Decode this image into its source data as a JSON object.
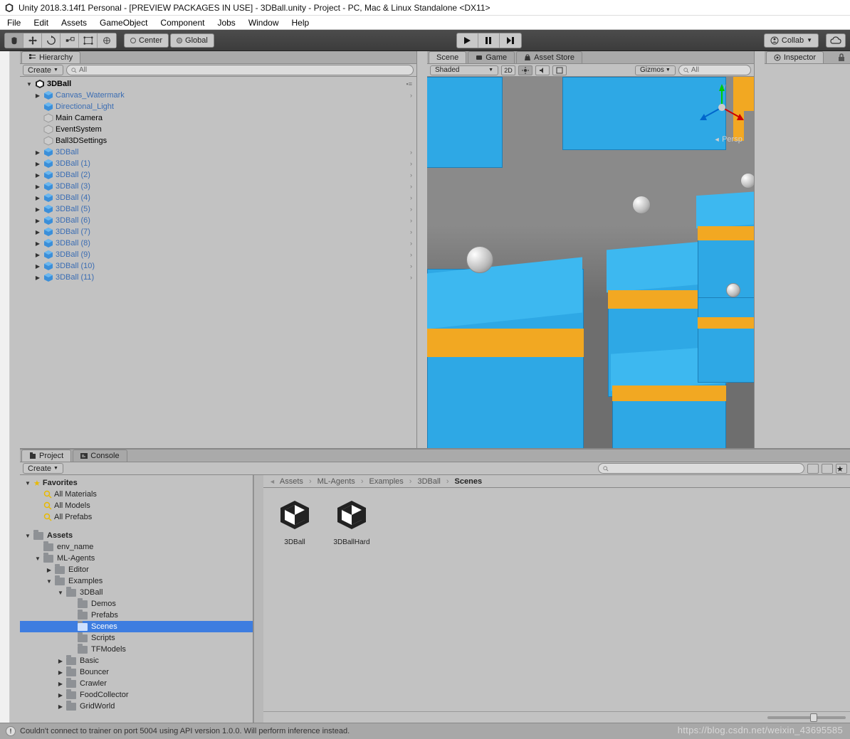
{
  "window_title": "Unity 2018.3.14f1 Personal - [PREVIEW PACKAGES IN USE] - 3DBall.unity - Project - PC, Mac & Linux Standalone <DX11>",
  "menus": [
    "File",
    "Edit",
    "Assets",
    "GameObject",
    "Component",
    "Jobs",
    "Window",
    "Help"
  ],
  "toolbar": {
    "pivot_labels": [
      "Center",
      "Global"
    ],
    "collab": "Collab"
  },
  "hierarchy": {
    "tab": "Hierarchy",
    "create": "Create",
    "search_placeholder": "All",
    "root": "3DBall",
    "items": [
      {
        "label": "Canvas_Watermark",
        "blue": true,
        "arrow": "closed",
        "chev": true
      },
      {
        "label": "Directional_Light",
        "blue": true,
        "arrow": "none",
        "chev": false
      },
      {
        "label": "Main Camera",
        "blue": false,
        "arrow": "none",
        "chev": false,
        "dim": true
      },
      {
        "label": "EventSystem",
        "blue": false,
        "arrow": "none",
        "chev": false,
        "dim": true
      },
      {
        "label": "Ball3DSettings",
        "blue": false,
        "arrow": "none",
        "chev": false,
        "dim": true
      },
      {
        "label": "3DBall",
        "blue": true,
        "arrow": "closed",
        "chev": true
      },
      {
        "label": "3DBall (1)",
        "blue": true,
        "arrow": "closed",
        "chev": true
      },
      {
        "label": "3DBall (2)",
        "blue": true,
        "arrow": "closed",
        "chev": true
      },
      {
        "label": "3DBall (3)",
        "blue": true,
        "arrow": "closed",
        "chev": true
      },
      {
        "label": "3DBall (4)",
        "blue": true,
        "arrow": "closed",
        "chev": true
      },
      {
        "label": "3DBall (5)",
        "blue": true,
        "arrow": "closed",
        "chev": true
      },
      {
        "label": "3DBall (6)",
        "blue": true,
        "arrow": "closed",
        "chev": true
      },
      {
        "label": "3DBall (7)",
        "blue": true,
        "arrow": "closed",
        "chev": true
      },
      {
        "label": "3DBall (8)",
        "blue": true,
        "arrow": "closed",
        "chev": true
      },
      {
        "label": "3DBall (9)",
        "blue": true,
        "arrow": "closed",
        "chev": true
      },
      {
        "label": "3DBall (10)",
        "blue": true,
        "arrow": "closed",
        "chev": true
      },
      {
        "label": "3DBall (11)",
        "blue": true,
        "arrow": "closed",
        "chev": true
      }
    ]
  },
  "scene": {
    "tabs": [
      "Scene",
      "Game",
      "Asset Store"
    ],
    "shading": "Shaded",
    "controls": {
      "2d": "2D",
      "gizmos": "Gizmos",
      "search": "All"
    },
    "persp": "Persp"
  },
  "inspector": {
    "tab": "Inspector"
  },
  "project": {
    "tabs": [
      "Project",
      "Console"
    ],
    "create": "Create",
    "breadcrumb": [
      "Assets",
      "ML-Agents",
      "Examples",
      "3DBall",
      "Scenes"
    ],
    "favorites_label": "Favorites",
    "favorites": [
      "All Materials",
      "All Models",
      "All Prefabs"
    ],
    "assets_label": "Assets",
    "tree": [
      {
        "l": "env_name",
        "d": 1,
        "arrow": "none"
      },
      {
        "l": "ML-Agents",
        "d": 1,
        "arrow": "open"
      },
      {
        "l": "Editor",
        "d": 2,
        "arrow": "closed"
      },
      {
        "l": "Examples",
        "d": 2,
        "arrow": "open"
      },
      {
        "l": "3DBall",
        "d": 3,
        "arrow": "open"
      },
      {
        "l": "Demos",
        "d": 4,
        "arrow": "none"
      },
      {
        "l": "Prefabs",
        "d": 4,
        "arrow": "none"
      },
      {
        "l": "Scenes",
        "d": 4,
        "arrow": "none",
        "selected": true
      },
      {
        "l": "Scripts",
        "d": 4,
        "arrow": "none"
      },
      {
        "l": "TFModels",
        "d": 4,
        "arrow": "none"
      },
      {
        "l": "Basic",
        "d": 3,
        "arrow": "closed"
      },
      {
        "l": "Bouncer",
        "d": 3,
        "arrow": "closed"
      },
      {
        "l": "Crawler",
        "d": 3,
        "arrow": "closed"
      },
      {
        "l": "FoodCollector",
        "d": 3,
        "arrow": "closed"
      },
      {
        "l": "GridWorld",
        "d": 3,
        "arrow": "closed"
      }
    ],
    "grid_items": [
      "3DBall",
      "3DBallHard"
    ]
  },
  "statusbar": {
    "message": "Couldn't connect to trainer on port 5004 using API version 1.0.0. Will perform inference instead."
  },
  "watermark": "https://blog.csdn.net/weixin_43695585"
}
